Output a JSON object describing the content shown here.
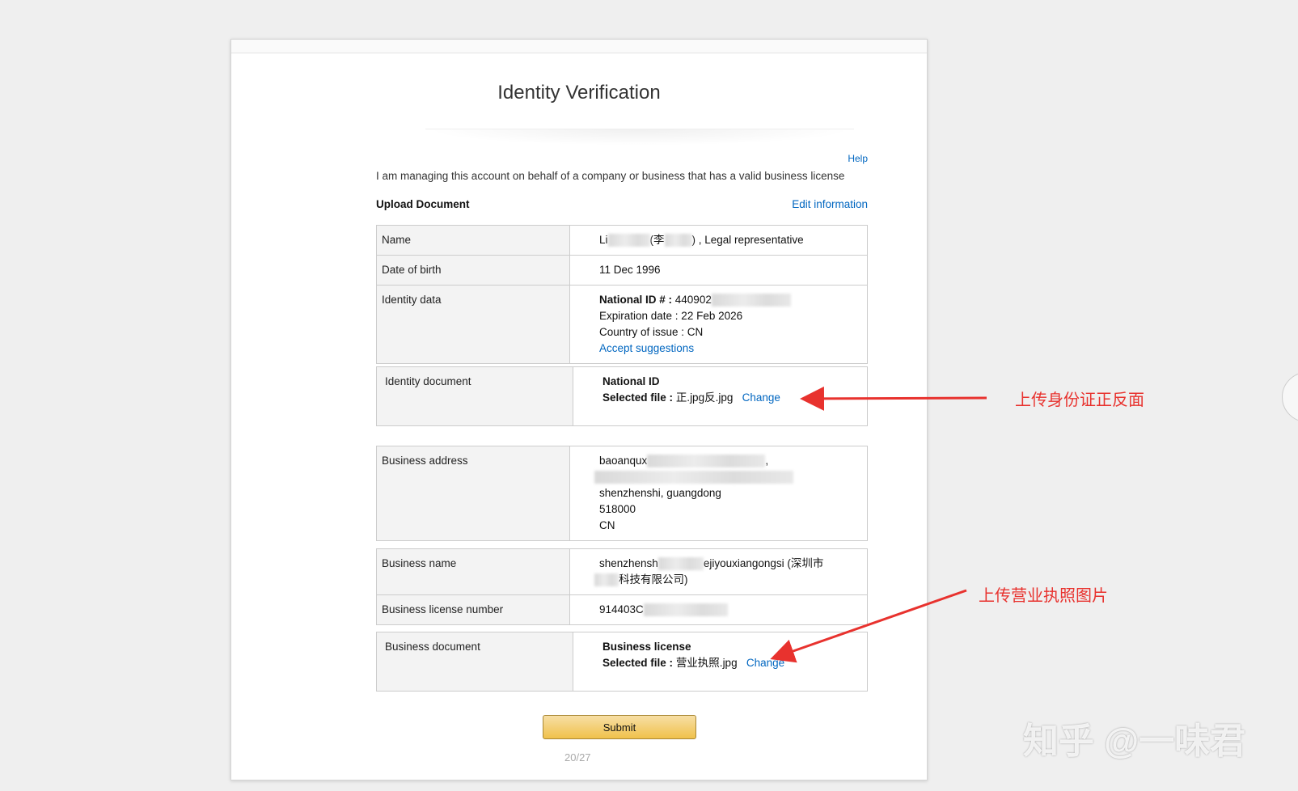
{
  "page": {
    "title": "Identity Verification",
    "help": "Help",
    "intro": "I am managing this account on behalf of a company or business that has a valid business license",
    "upload_heading": "Upload Document",
    "edit_link": "Edit information",
    "page_number": "20/27"
  },
  "personal": {
    "name_label": "Name",
    "name_prefix": "Li",
    "name_mid": "(李",
    "name_suffix": ") , Legal representative",
    "dob_label": "Date of birth",
    "dob_value": "11 Dec 1996",
    "identity_label": "Identity data",
    "national_id_label": "National ID # :",
    "national_id_value": "440902",
    "expiration": "Expiration date : 22 Feb 2026",
    "country": "Country of issue : CN",
    "accept_suggestions": "Accept suggestions"
  },
  "identity_doc": {
    "label": "Identity document",
    "doc_type": "National ID",
    "selected_label": "Selected file :",
    "selected_value": "正.jpg反.jpg",
    "change": "Change"
  },
  "address": {
    "label": "Business address",
    "line1": "baoanqux",
    "line1_end": ",",
    "line3": "shenzhenshi, guangdong",
    "line4": "518000",
    "line5": "CN"
  },
  "business": {
    "name_label": "Business name",
    "name_part1": "shenzhensh",
    "name_part2": "ejiyouxiangongsi (深圳市",
    "name_part3": "科技有限公司)",
    "license_label": "Business license number",
    "license_value": "914403C"
  },
  "business_doc": {
    "label": "Business document",
    "doc_type": "Business license",
    "selected_label": "Selected file :",
    "selected_value": "营业执照.jpg",
    "change": "Change"
  },
  "submit": "Submit",
  "annotations": {
    "id_note": "上传身份证正反面",
    "license_note": "上传营业执照图片"
  },
  "watermark": "知乎 @一味君",
  "colors": {
    "link": "#0066c0",
    "annotation": "#e8322e",
    "button": "#f0c14b"
  }
}
